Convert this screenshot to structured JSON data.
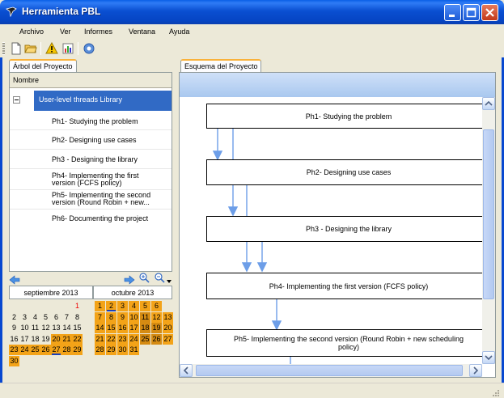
{
  "window": {
    "title": "Herramienta PBL"
  },
  "menu": [
    "Archivo",
    "Ver",
    "Informes",
    "Ventana",
    "Ayuda"
  ],
  "toolbar": {
    "icons": [
      "new-icon",
      "open-icon",
      "warning-icon",
      "chart-icon",
      "settings-icon"
    ]
  },
  "left_tab": {
    "label": "Árbol del Proyecto"
  },
  "tree": {
    "column_header": "Nombre",
    "root": "User-level threads Library",
    "items": [
      {
        "label": "Ph1-  Studying the problem"
      },
      {
        "label": "Ph2- Designing use cases"
      },
      {
        "label": "Ph3 - Designing the library"
      },
      {
        "label": "Ph4- Implementing the first\nversion (FCFS policy)"
      },
      {
        "label": "Ph5- Implementing the second\nversion (Round Robin + new..."
      },
      {
        "label": "Ph6- Documenting the project"
      }
    ]
  },
  "calendar": {
    "month1": "septiembre 2013",
    "month2": "octubre 2013",
    "rows": [
      {
        "sept": [
          "",
          "",
          "",
          "",
          "",
          "",
          "1"
        ],
        "oct": [
          "1",
          "2",
          "3",
          "4",
          "5",
          "6"
        ]
      },
      {
        "sept": [
          "2",
          "3",
          "4",
          "5",
          "6",
          "7",
          "8"
        ],
        "oct": [
          "7",
          "8",
          "9",
          "10",
          "11",
          "12",
          "13"
        ]
      },
      {
        "sept": [
          "9",
          "10",
          "11",
          "12",
          "13",
          "14",
          "15"
        ],
        "oct": [
          "14",
          "15",
          "16",
          "17",
          "18",
          "19",
          "20"
        ]
      },
      {
        "sept": [
          "16",
          "17",
          "18",
          "19",
          "20",
          "21",
          "22"
        ],
        "oct": [
          "21",
          "22",
          "23",
          "24",
          "25",
          "26",
          "27"
        ]
      },
      {
        "sept": [
          "23",
          "24",
          "25",
          "26",
          "27",
          "28",
          "29"
        ],
        "oct": [
          "28",
          "29",
          "30",
          "31"
        ]
      },
      {
        "sept": [
          "30"
        ],
        "oct": []
      }
    ]
  },
  "right_tab": {
    "label": "Esquema del Proyecto"
  },
  "diagram": {
    "boxes": [
      {
        "label": "Ph1-  Studying the problem"
      },
      {
        "label": "Ph2- Designing use cases"
      },
      {
        "label": "Ph3 - Designing the library"
      },
      {
        "label": "Ph4- Implementing the first  version (FCFS  policy)"
      },
      {
        "label": "Ph5- Implementing the second version (Round Robin + new scheduling policy)"
      }
    ]
  },
  "colors": {
    "accent": "#316ac5",
    "calendar_highlight": "#f3a318",
    "arrow": "#6d9ee8"
  }
}
